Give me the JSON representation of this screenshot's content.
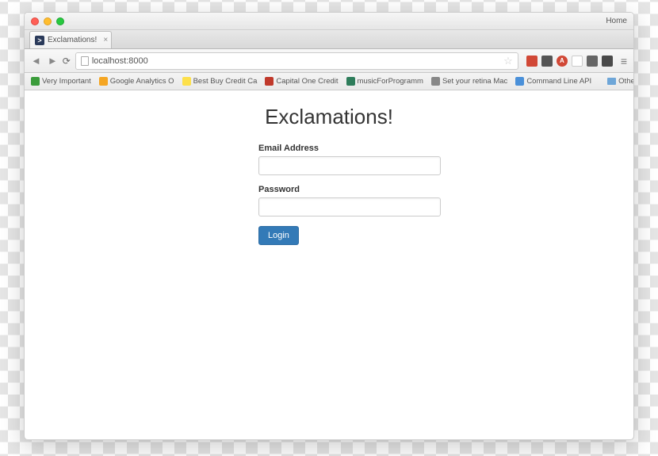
{
  "window": {
    "home_label": "Home"
  },
  "tab": {
    "title": "Exclamations!",
    "favicon_char": ">"
  },
  "toolbar": {
    "url": "localhost:8000"
  },
  "bookmarks": {
    "items": [
      {
        "label": "Very Important",
        "color": "#3b9c3b"
      },
      {
        "label": "Google Analytics O",
        "color": "#f5a623"
      },
      {
        "label": "Best Buy Credit Ca",
        "color": "#fde04b"
      },
      {
        "label": "Capital One Credit",
        "color": "#c0392b"
      },
      {
        "label": "musicForProgramm",
        "color": "#2e7d5b"
      },
      {
        "label": "Set your retina Mac",
        "color": "#888"
      },
      {
        "label": "Command Line API",
        "color": "#4a90d9"
      }
    ],
    "other_label": "Other Bookmarks"
  },
  "extensions": [
    {
      "bg": "#d14836",
      "char": ""
    },
    {
      "bg": "#555",
      "char": ""
    },
    {
      "bg": "#d14836",
      "char": "A"
    },
    {
      "bg": "#fff",
      "char": "",
      "border": true
    },
    {
      "bg": "#666",
      "char": ""
    },
    {
      "bg": "#4a4a4a",
      "char": ""
    }
  ],
  "page": {
    "title": "Exclamations!",
    "email_label": "Email Address",
    "password_label": "Password",
    "login_label": "Login"
  }
}
